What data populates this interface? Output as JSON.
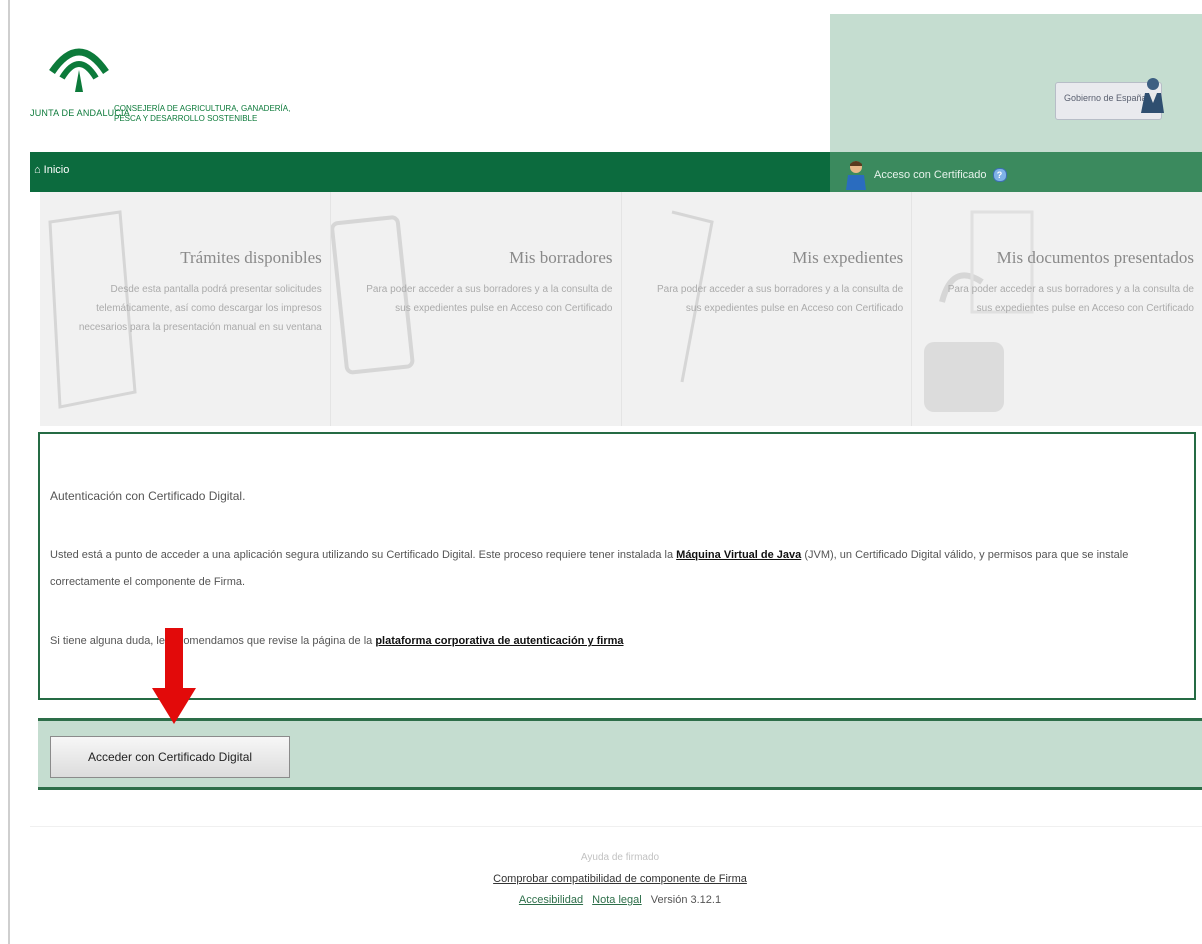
{
  "header": {
    "logo_left_text": "JUNTA DE ANDALUCIA",
    "logo_right_line1": "CONSEJERÍA DE AGRICULTURA, GANADERÍA,",
    "logo_right_line2": "PESCA Y DESARROLLO SOSTENIBLE",
    "badge_text": "Gobierno de España"
  },
  "nav": {
    "home_label": "Inicio",
    "cert_label": "Acceso con Certificado"
  },
  "tiles": [
    {
      "title": "Trámites disponibles",
      "desc": "Desde esta pantalla podrá presentar solicitudes telemáticamente, así como descargar los impresos necesarios para la presentación manual en su ventana"
    },
    {
      "title": "Mis borradores",
      "desc": "Para poder acceder a sus borradores y a la consulta de sus expedientes pulse en Acceso con Certificado"
    },
    {
      "title": "Mis expedientes",
      "desc": "Para poder acceder a sus borradores y a la consulta de sus expedientes pulse en Acceso con Certificado"
    },
    {
      "title": "Mis documentos presentados",
      "desc": "Para poder acceder a sus borradores y a la consulta de sus expedientes pulse en Acceso con Certificado"
    }
  ],
  "info": {
    "title": "Autenticación con Certificado Digital.",
    "p1_before": "Usted está a punto de acceder a una aplicación segura utilizando su Certificado Digital. Este proceso requiere tener instalada la ",
    "p1_link": "Máquina Virtual de Java",
    "p1_after": " (JVM), un Certificado Digital válido, y permisos para que se instale correctamente el componente de Firma.",
    "p2_before": "Si tiene alguna duda, le recomendamos que revise la página de la ",
    "p2_link": "plataforma corporativa de autenticación y firma"
  },
  "action": {
    "button_label": "Acceder con Certificado Digital"
  },
  "footer": {
    "caption": "Ayuda de firmado",
    "compat_link": "Comprobar compatibilidad de componente de Firma",
    "accessibility": "Accesibilidad",
    "legal": "Nota legal",
    "version": "Versión 3.12.1"
  },
  "colors": {
    "nav_green": "#0c6b3e",
    "light_green": "#c5ddd0",
    "arrow_red": "#e20a0a"
  }
}
